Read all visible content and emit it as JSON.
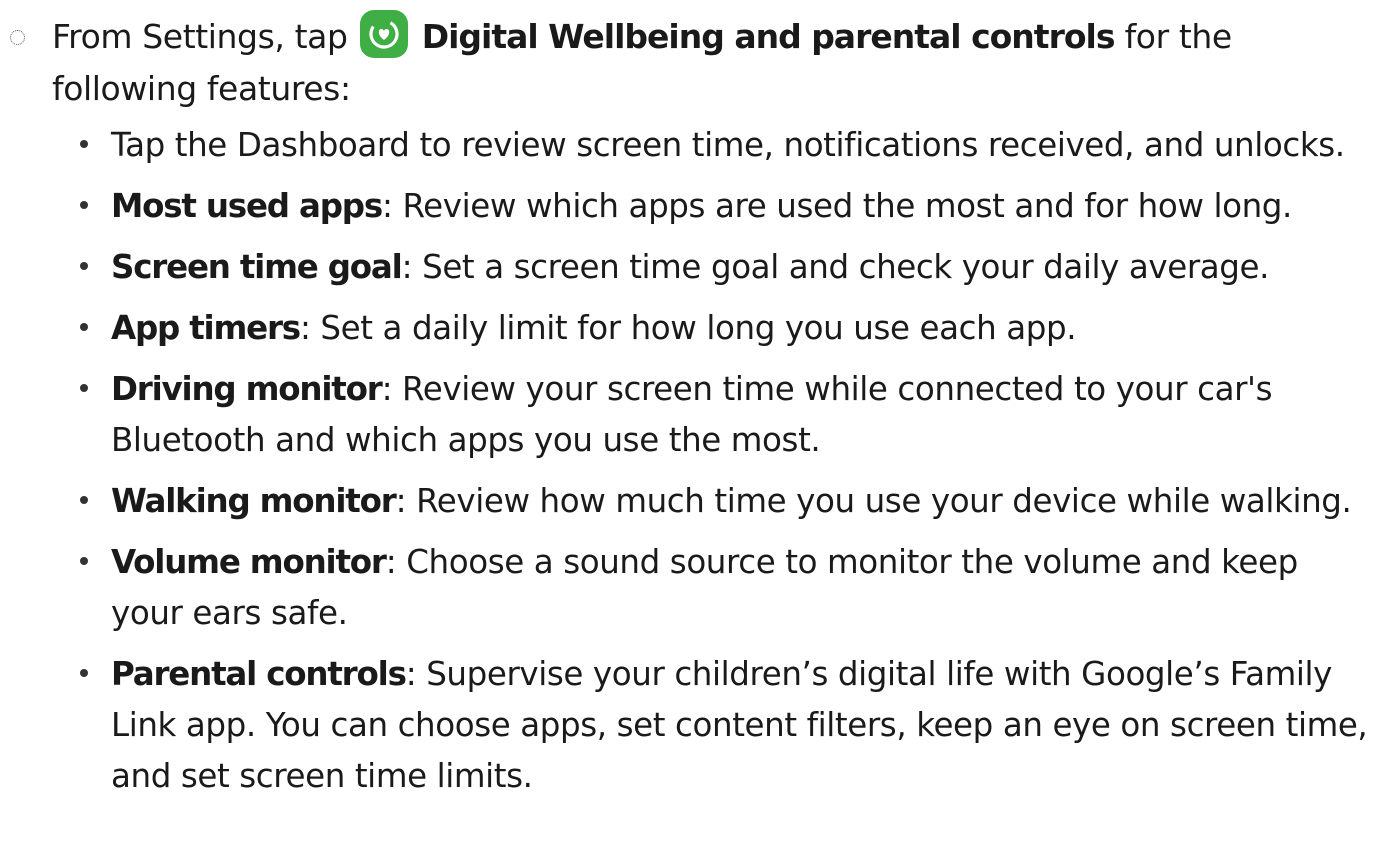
{
  "intro": {
    "prefix": "From Settings, tap",
    "app_name": "Digital Wellbeing and parental controls",
    "suffix": "for the following features:",
    "icon": "digital-wellbeing-icon",
    "icon_color": "#3fae45"
  },
  "features": [
    {
      "term": "",
      "text": "Tap the Dashboard to review screen time, notifications received, and unlocks."
    },
    {
      "term": "Most used apps",
      "text": ": Review which apps are used the most and for how long."
    },
    {
      "term": "Screen time goal",
      "text": ": Set a screen time goal and check your daily average."
    },
    {
      "term": "App timers",
      "text": ": Set a daily limit for how long you use each app."
    },
    {
      "term": "Driving monitor",
      "text": ": Review your screen time while connected to your car's Bluetooth and which apps you use the most."
    },
    {
      "term": "Walking monitor",
      "text": ": Review how much time you use your device while walking."
    },
    {
      "term": "Volume monitor",
      "text": ": Choose a sound source to monitor the volume and keep your ears safe."
    },
    {
      "term": "Parental controls",
      "text": ": Supervise your children’s digital life with Google’s Family Link app. You can choose apps, set content filters, keep an eye on screen time, and set screen time limits."
    }
  ]
}
